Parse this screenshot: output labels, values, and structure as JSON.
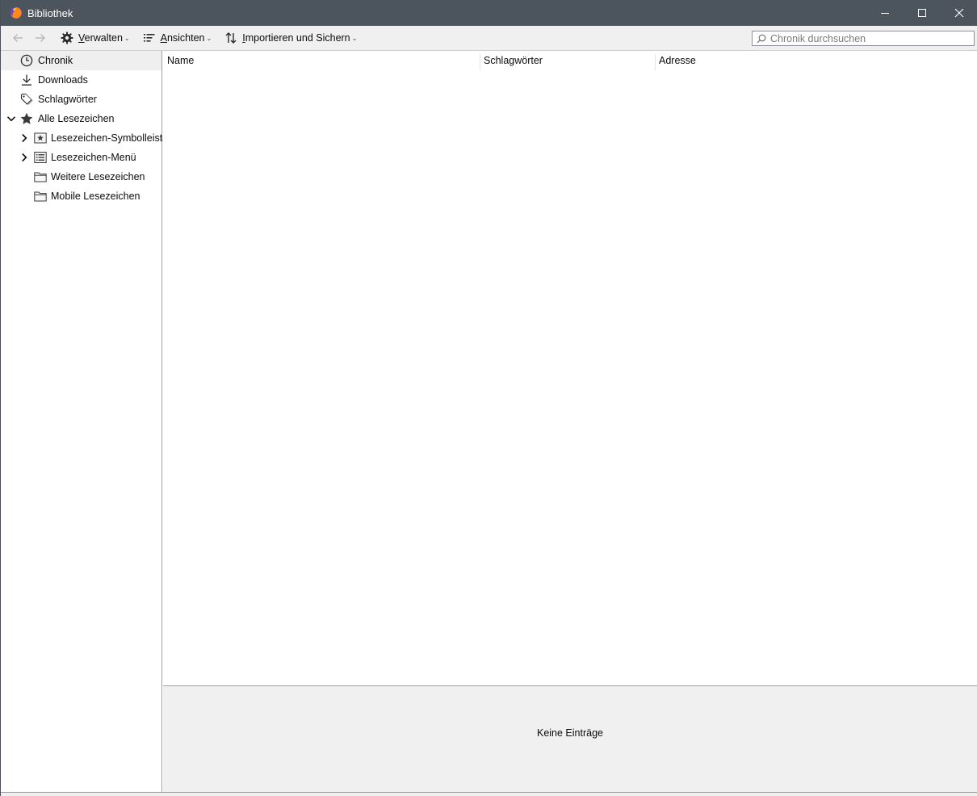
{
  "window": {
    "title": "Bibliothek",
    "app_icon": "firefox-icon",
    "controls": [
      "minimize-icon",
      "maximize-icon",
      "close-icon"
    ],
    "titlebar_color": "#4c545d"
  },
  "toolbar": {
    "back_icon": "arrow-left-icon",
    "forward_icon": "arrow-right-icon",
    "manage_label": "Verwalten",
    "views_label": "Ansichten",
    "import_label": "Importieren und Sichern",
    "search_placeholder": "Chronik durchsuchen"
  },
  "sidebar": {
    "items": [
      {
        "label": "Chronik",
        "icon": "clock-icon",
        "selected": true
      },
      {
        "label": "Downloads",
        "icon": "download-icon"
      },
      {
        "label": "Schlagwörter",
        "icon": "tag-icon"
      },
      {
        "label": "Alle Lesezeichen",
        "icon": "star-icon",
        "expanded": true
      },
      {
        "label": "Lesezeichen-Symbolleiste",
        "icon": "bookmarks-toolbar-icon",
        "collapsed": true
      },
      {
        "label": "Lesezeichen-Menü",
        "icon": "bookmarks-menu-icon",
        "collapsed": true
      },
      {
        "label": "Weitere Lesezeichen",
        "icon": "folder-icon"
      },
      {
        "label": "Mobile Lesezeichen",
        "icon": "folder-icon"
      }
    ]
  },
  "main": {
    "columns": [
      "Name",
      "Schlagwörter",
      "Adresse"
    ],
    "details_message": "Keine Einträge"
  }
}
